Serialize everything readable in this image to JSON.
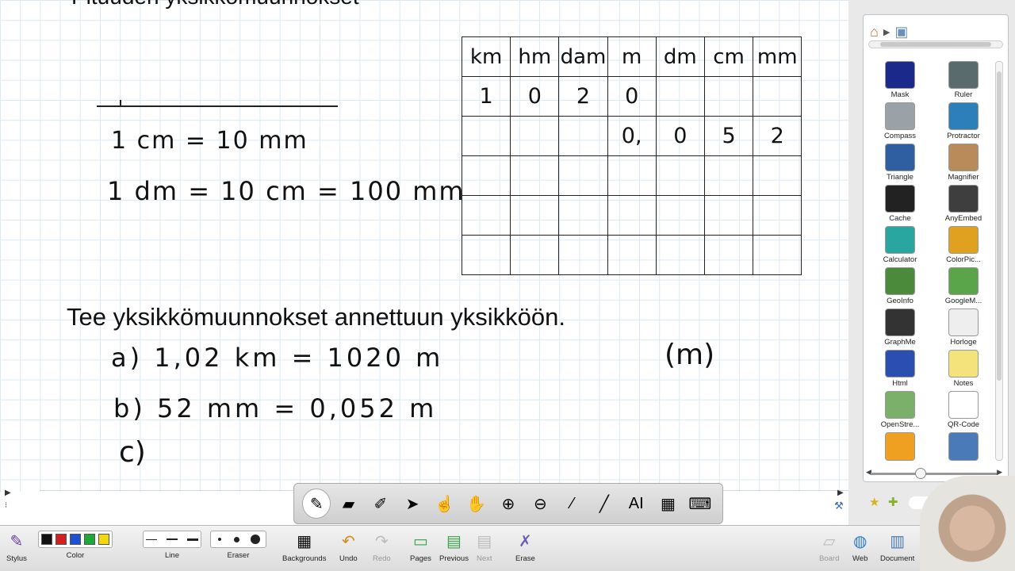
{
  "board": {
    "title_fragment": "Pituuden yksikkömuunnokset",
    "eq1": "1 cm = 10 mm",
    "eq2": "1 dm = 10 cm = 100 mm",
    "table": {
      "headers": [
        "km",
        "hm",
        "dam",
        "m",
        "dm",
        "cm",
        "mm"
      ],
      "rows": [
        [
          "1",
          "0",
          "2",
          "0",
          "",
          "",
          ""
        ],
        [
          "",
          "",
          "",
          "0,",
          "0",
          "5",
          "2"
        ],
        [
          "",
          "",
          "",
          "",
          "",
          "",
          ""
        ],
        [
          "",
          "",
          "",
          "",
          "",
          "",
          ""
        ],
        [
          "",
          "",
          "",
          "",
          "",
          "",
          ""
        ]
      ]
    },
    "instruction": "Tee yksikkömuunnokset annettuun yksikköön.",
    "row_a": "a)  1,02  km = 1020  m",
    "row_b": "b)   52  mm = 0,052     m",
    "row_c": "c)",
    "unit_hint": "(m)"
  },
  "gallery": {
    "items": [
      {
        "label": "Mask",
        "icon": "mask-icon",
        "color": "#1b2a8a"
      },
      {
        "label": "Ruler",
        "icon": "ruler-icon",
        "color": "#5a6b6e"
      },
      {
        "label": "Compass",
        "icon": "compass-icon",
        "color": "#9aa2a8"
      },
      {
        "label": "Protractor",
        "icon": "protractor-icon",
        "color": "#2c7fb8"
      },
      {
        "label": "Triangle",
        "icon": "triangle-icon",
        "color": "#2f5fa0"
      },
      {
        "label": "Magnifier",
        "icon": "magnifier-icon",
        "color": "#b98a5a"
      },
      {
        "label": "Cache",
        "icon": "cache-icon",
        "color": "#222222"
      },
      {
        "label": "AnyEmbed",
        "icon": "anyembed-icon",
        "color": "#3e3e3e"
      },
      {
        "label": "Calculator",
        "icon": "calculator-icon",
        "color": "#2aa6a0"
      },
      {
        "label": "ColorPic...",
        "icon": "colorpicker-icon",
        "color": "#e0a020"
      },
      {
        "label": "GeoInfo",
        "icon": "geoinfo-icon",
        "color": "#4a8a3a"
      },
      {
        "label": "GoogleM...",
        "icon": "googlemaps-icon",
        "color": "#5aa44a"
      },
      {
        "label": "GraphMe",
        "icon": "graphme-icon",
        "color": "#333333"
      },
      {
        "label": "Horloge",
        "icon": "clock-icon",
        "color": "#eeeeee"
      },
      {
        "label": "Html",
        "icon": "html-icon",
        "color": "#2a4fb0"
      },
      {
        "label": "Notes",
        "icon": "notes-icon",
        "color": "#f4e27a"
      },
      {
        "label": "OpenStre...",
        "icon": "openstreetmap-icon",
        "color": "#7ab06a"
      },
      {
        "label": "QR-Code",
        "icon": "qrcode-icon",
        "color": "#ffffff"
      },
      {
        "label": "",
        "icon": "stopwatch-icon",
        "color": "#f0a020"
      },
      {
        "label": "",
        "icon": "video-icon",
        "color": "#4a7ab8"
      }
    ]
  },
  "float_toolbar": {
    "tools": [
      {
        "name": "pen-tool-icon",
        "glyph": "✎",
        "active": true
      },
      {
        "name": "eraser-tool-icon",
        "glyph": "▰"
      },
      {
        "name": "marker-tool-icon",
        "glyph": "✐"
      },
      {
        "name": "select-tool-icon",
        "glyph": "➤"
      },
      {
        "name": "interact-tool-icon",
        "glyph": "☝"
      },
      {
        "name": "hand-tool-icon",
        "glyph": "✋"
      },
      {
        "name": "zoom-in-icon",
        "glyph": "⊕"
      },
      {
        "name": "zoom-out-icon",
        "glyph": "⊖"
      },
      {
        "name": "laser-pointer-icon",
        "glyph": "⁄"
      },
      {
        "name": "line-tool-icon",
        "glyph": "╱"
      },
      {
        "name": "text-tool-icon",
        "glyph": "AI"
      },
      {
        "name": "capture-tool-icon",
        "glyph": "▦"
      },
      {
        "name": "keyboard-icon",
        "glyph": "⌨"
      }
    ]
  },
  "bottom_bar": {
    "stylus": "Stylus",
    "color": "Color",
    "colors": [
      "#111111",
      "#d21f1f",
      "#1f4fd2",
      "#1fa83a",
      "#f2d80f"
    ],
    "line": "Line",
    "eraser": "Eraser",
    "backgrounds": "Backgrounds",
    "undo": "Undo",
    "redo": "Redo",
    "pages": "Pages",
    "previous": "Previous",
    "next": "Next",
    "erase": "Erase",
    "board": "Board",
    "web": "Web",
    "documents": "Document"
  }
}
